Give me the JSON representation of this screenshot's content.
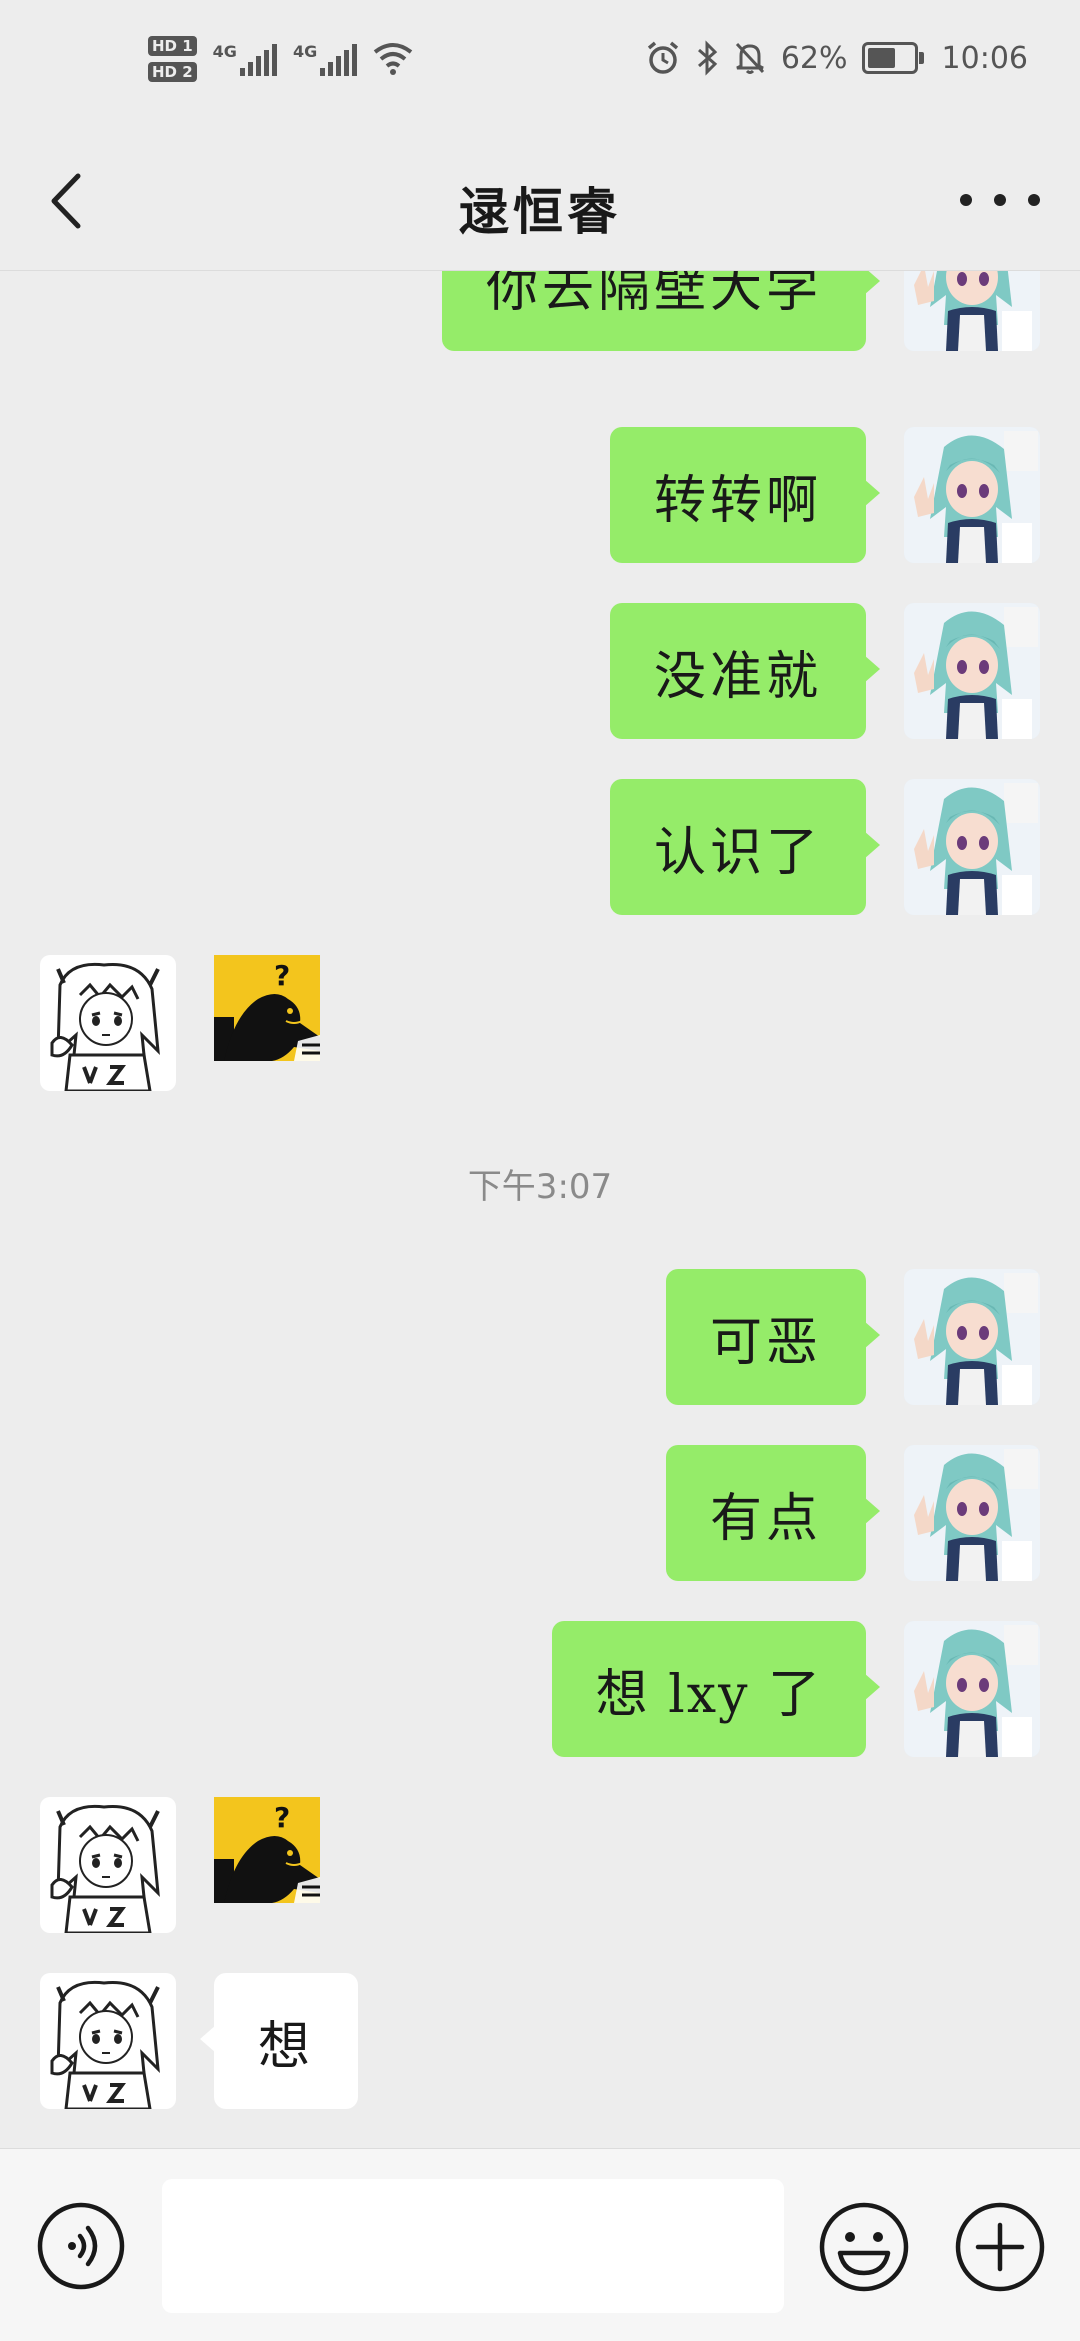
{
  "status_bar": {
    "sim1": "HD 1",
    "sim2": "HD 2",
    "network1": "4G",
    "network2": "4G",
    "battery_percent": "62%",
    "battery_level": 0.62,
    "time": "10:06",
    "icons": [
      "alarm-icon",
      "bluetooth-icon",
      "mute-icon",
      "battery-icon",
      "wifi-icon",
      "signal-icon"
    ]
  },
  "header": {
    "title": "逯恒睿",
    "back_icon": "chevron-left-icon",
    "more_icon": "more-dots-icon"
  },
  "colors": {
    "background": "#ededed",
    "outgoing_bubble": "#95ec69",
    "incoming_bubble": "#ffffff",
    "timestamp_text": "#8a8a8a"
  },
  "messages": [
    {
      "direction": "out",
      "text": "你去隔壁大学",
      "avatar": "self-avatar"
    },
    {
      "direction": "out",
      "text": "转转啊",
      "avatar": "self-avatar"
    },
    {
      "direction": "out",
      "text": "没准就",
      "avatar": "self-avatar"
    },
    {
      "direction": "out",
      "text": "认识了",
      "avatar": "self-avatar"
    },
    {
      "direction": "in",
      "type": "sticker",
      "sticker": "confused-duck-sticker",
      "avatar": "contact-avatar"
    },
    {
      "direction": "out",
      "text": "可恶",
      "avatar": "self-avatar"
    },
    {
      "direction": "out",
      "text": "有点",
      "avatar": "self-avatar"
    },
    {
      "direction": "out",
      "text": "想 lxy 了",
      "avatar": "self-avatar"
    },
    {
      "direction": "in",
      "type": "sticker",
      "sticker": "confused-duck-sticker",
      "avatar": "contact-avatar"
    },
    {
      "direction": "in",
      "text": "想",
      "avatar": "contact-avatar"
    }
  ],
  "timestamp": "下午3:07",
  "input_bar": {
    "voice_icon": "voice-icon",
    "input_value": "",
    "emoji_icon": "emoji-icon",
    "plus_icon": "plus-icon"
  }
}
